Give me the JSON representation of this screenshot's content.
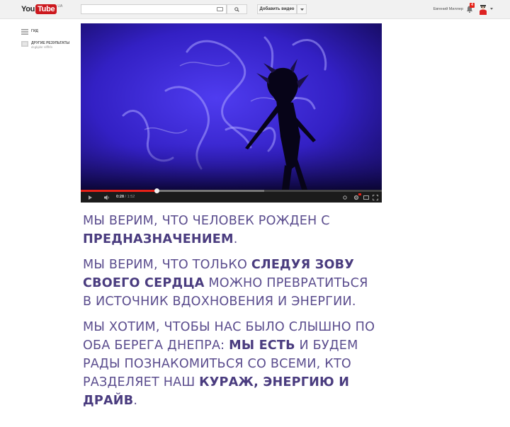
{
  "header": {
    "logo_you": "You",
    "logo_tube": "Tube",
    "logo_region": "UA",
    "search_placeholder": "",
    "upload_label": "Добавить видео",
    "username": "Евгений Миллер",
    "notification_count": "4"
  },
  "guide": {
    "items": [
      {
        "label": "ГИД",
        "sub": ""
      },
      {
        "label": "ДРУГИЕ РЕЗУЛЬТАТЫ",
        "sub": "dcgkjdsr nlffhfn"
      }
    ]
  },
  "player": {
    "current_time": "0:28",
    "duration": "/ 1:52",
    "played_fraction": 0.254,
    "buffered_fraction": 0.61
  },
  "content": {
    "p1": {
      "t1": "Мы верим, что человек рожден с ",
      "b1": "предназначением",
      "t2": "."
    },
    "p2": {
      "t1": "Мы верим, что только ",
      "b1": "следуя зову своего сердца",
      "t2": " можно превратиться в источник вдохновения и энергии."
    },
    "p3": {
      "t1": "Мы хотим, чтобы нас было слышно по оба берега Днепра: ",
      "b1": "мы есть",
      "t2": " и будем рады познакомиться со всеми, кто разделяет наш ",
      "b2": "кураж, энергию и драйв",
      "t3": "."
    }
  },
  "colors": {
    "text": "#5b4d8e",
    "brand_red": "#cc181e",
    "video_blue": "#3a20c8"
  }
}
